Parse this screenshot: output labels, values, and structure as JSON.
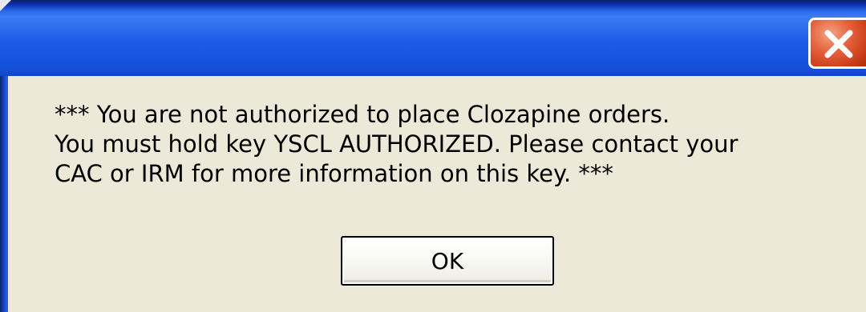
{
  "dialog": {
    "title": "",
    "close_icon": "close-icon",
    "message_lines": [
      "*** You are not authorized to place Clozapine orders.",
      "You must hold key YSCL AUTHORIZED.  Please contact your",
      "CAC or IRM for more information on this key. ***"
    ],
    "ok_label": "OK"
  },
  "colors": {
    "titlebar": "#2f6ff0",
    "client_background": "#ece9d8",
    "close_button": "#e4623c"
  }
}
